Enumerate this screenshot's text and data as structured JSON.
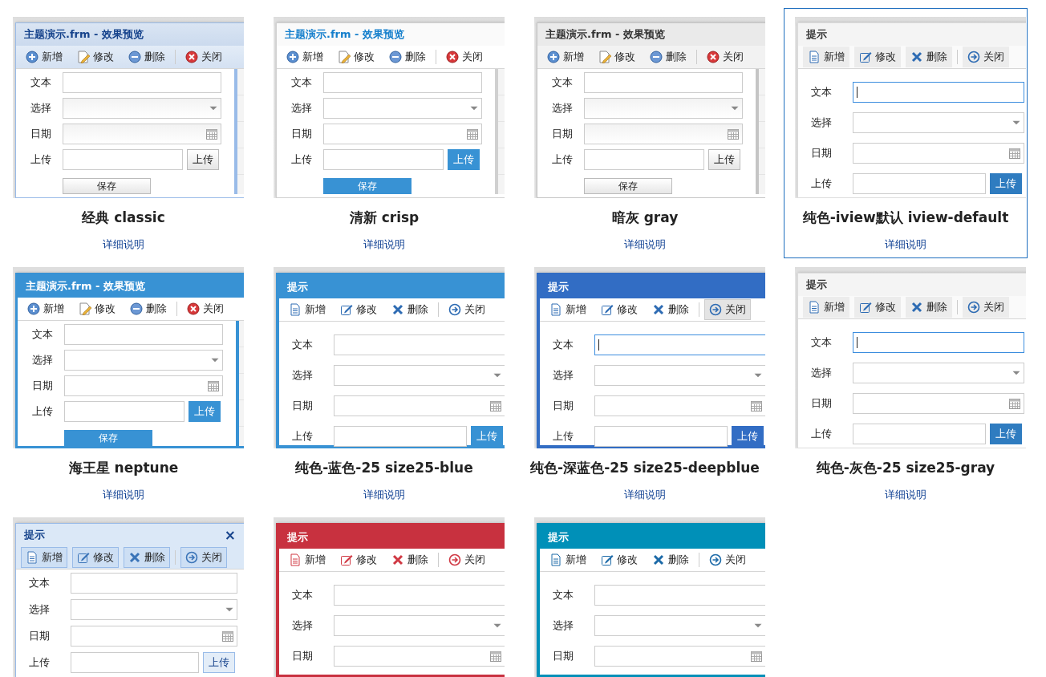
{
  "themes": [
    {
      "kind": "classic",
      "window_title": "主题演示.frm - 效果预览",
      "toolbar": [
        {
          "label": "新增"
        },
        {
          "label": "修改"
        },
        {
          "label": "删除"
        },
        {
          "label": "关闭"
        }
      ],
      "fields": [
        {
          "label": "文本",
          "kind": "text"
        },
        {
          "label": "选择",
          "kind": "select"
        },
        {
          "label": "日期",
          "kind": "date"
        },
        {
          "label": "上传",
          "kind": "upload",
          "button": "上传"
        }
      ],
      "save_button": "保存",
      "name": "经典 classic",
      "link": "详细说明",
      "selected": false
    },
    {
      "kind": "crisp",
      "window_title": "主题演示.frm - 效果预览",
      "toolbar": [
        {
          "label": "新增"
        },
        {
          "label": "修改"
        },
        {
          "label": "删除"
        },
        {
          "label": "关闭"
        }
      ],
      "fields": [
        {
          "label": "文本",
          "kind": "text"
        },
        {
          "label": "选择",
          "kind": "select"
        },
        {
          "label": "日期",
          "kind": "date"
        },
        {
          "label": "上传",
          "kind": "upload",
          "button": "上传"
        }
      ],
      "save_button": "保存",
      "name": "清新 crisp",
      "link": "详细说明",
      "selected": false
    },
    {
      "kind": "gray",
      "window_title": "主题演示.frm - 效果预览",
      "toolbar": [
        {
          "label": "新增"
        },
        {
          "label": "修改"
        },
        {
          "label": "删除"
        },
        {
          "label": "关闭"
        }
      ],
      "fields": [
        {
          "label": "文本",
          "kind": "text"
        },
        {
          "label": "选择",
          "kind": "select"
        },
        {
          "label": "日期",
          "kind": "date"
        },
        {
          "label": "上传",
          "kind": "upload",
          "button": "上传"
        }
      ],
      "save_button": "保存",
      "name": "暗灰 gray",
      "link": "详细说明",
      "selected": false
    },
    {
      "kind": "iview",
      "window_title": "提示",
      "toolbar": [
        {
          "label": "新增"
        },
        {
          "label": "修改"
        },
        {
          "label": "删除"
        },
        {
          "label": "关闭"
        }
      ],
      "fields": [
        {
          "label": "文本",
          "kind": "text",
          "focused": true
        },
        {
          "label": "选择",
          "kind": "select"
        },
        {
          "label": "日期",
          "kind": "date"
        },
        {
          "label": "上传",
          "kind": "upload",
          "button": "上传"
        }
      ],
      "name": "纯色-iview默认 iview-default",
      "link": "详细说明",
      "selected": true
    },
    {
      "kind": "neptune",
      "window_title": "主题演示.frm - 效果预览",
      "toolbar": [
        {
          "label": "新增"
        },
        {
          "label": "修改"
        },
        {
          "label": "删除"
        },
        {
          "label": "关闭"
        }
      ],
      "fields": [
        {
          "label": "文本",
          "kind": "text"
        },
        {
          "label": "选择",
          "kind": "select"
        },
        {
          "label": "日期",
          "kind": "date"
        },
        {
          "label": "上传",
          "kind": "upload",
          "button": "上传"
        }
      ],
      "save_button": "保存",
      "name": "海王星 neptune",
      "link": "详细说明",
      "selected": false
    },
    {
      "kind": "blue",
      "window_title": "提示",
      "toolbar": [
        {
          "label": "新增"
        },
        {
          "label": "修改"
        },
        {
          "label": "删除"
        },
        {
          "label": "关闭"
        }
      ],
      "fields": [
        {
          "label": "文本",
          "kind": "text"
        },
        {
          "label": "选择",
          "kind": "select"
        },
        {
          "label": "日期",
          "kind": "date"
        },
        {
          "label": "上传",
          "kind": "upload",
          "button": "上传"
        }
      ],
      "name": "纯色-蓝色-25 size25-blue",
      "link": "详细说明",
      "selected": false
    },
    {
      "kind": "deepblue",
      "window_title": "提示",
      "toolbar": [
        {
          "label": "新增",
          "hovered": false
        },
        {
          "label": "修改",
          "hovered": false
        },
        {
          "label": "删除",
          "hovered": false
        },
        {
          "label": "关闭",
          "hovered": true
        }
      ],
      "fields": [
        {
          "label": "文本",
          "kind": "text",
          "focused": true
        },
        {
          "label": "选择",
          "kind": "select"
        },
        {
          "label": "日期",
          "kind": "date"
        },
        {
          "label": "上传",
          "kind": "upload",
          "button": "上传"
        }
      ],
      "name": "纯色-深蓝色-25 size25-deepblue",
      "link": "详细说明",
      "selected": false
    },
    {
      "kind": "gray25",
      "window_title": "提示",
      "toolbar": [
        {
          "label": "新增"
        },
        {
          "label": "修改"
        },
        {
          "label": "删除"
        },
        {
          "label": "关闭"
        }
      ],
      "fields": [
        {
          "label": "文本",
          "kind": "text",
          "focused": true
        },
        {
          "label": "选择",
          "kind": "select"
        },
        {
          "label": "日期",
          "kind": "date"
        },
        {
          "label": "上传",
          "kind": "upload",
          "button": "上传"
        }
      ],
      "name": "纯色-灰色-25 size25-gray",
      "link": "详细说明",
      "selected": false
    },
    {
      "kind": "lightblue",
      "window_title": "提示",
      "close_button": "×",
      "toolbar": [
        {
          "label": "新增"
        },
        {
          "label": "修改"
        },
        {
          "label": "删除"
        },
        {
          "label": "关闭"
        }
      ],
      "fields": [
        {
          "label": "文本",
          "kind": "text"
        },
        {
          "label": "选择",
          "kind": "select"
        },
        {
          "label": "日期",
          "kind": "date"
        },
        {
          "label": "上传",
          "kind": "upload",
          "button": "上传"
        }
      ],
      "selected": false
    },
    {
      "kind": "red",
      "window_title": "提示",
      "toolbar": [
        {
          "label": "新增"
        },
        {
          "label": "修改"
        },
        {
          "label": "删除"
        },
        {
          "label": "关闭"
        }
      ],
      "fields": [
        {
          "label": "文本",
          "kind": "text"
        },
        {
          "label": "选择",
          "kind": "select"
        },
        {
          "label": "日期",
          "kind": "date"
        }
      ],
      "selected": false
    },
    {
      "kind": "teal",
      "window_title": "提示",
      "toolbar": [
        {
          "label": "新增"
        },
        {
          "label": "修改"
        },
        {
          "label": "删除"
        },
        {
          "label": "关闭"
        }
      ],
      "fields": [
        {
          "label": "文本",
          "kind": "text"
        },
        {
          "label": "选择",
          "kind": "select"
        },
        {
          "label": "日期",
          "kind": "date"
        }
      ],
      "selected": false
    }
  ]
}
